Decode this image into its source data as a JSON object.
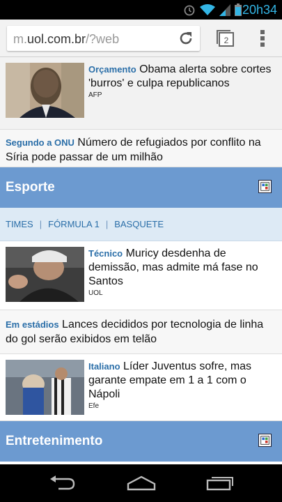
{
  "status_bar": {
    "time": "20h34",
    "icons": [
      "alarm-icon",
      "wifi-icon",
      "signal-icon",
      "battery-icon"
    ],
    "accent_color": "#33b5e5"
  },
  "browser": {
    "url_prefix": "m.",
    "url_domain": "uol.com.br",
    "url_suffix": "/?web",
    "tab_count": "2",
    "icons": [
      "reload-icon",
      "tabs-icon",
      "overflow-menu-icon"
    ]
  },
  "articles_top": [
    {
      "kicker": "Orçamento",
      "headline": "Obama alerta sobre cortes 'burros' e culpa republicanos",
      "source": "AFP"
    }
  ],
  "text_article_1": {
    "kicker": "Segundo a ONU",
    "headline": "Número de refugiados por conflito na Síria pode passar de um milhão"
  },
  "sections": {
    "esporte": {
      "title": "Esporte",
      "color": "#6c9ad0"
    },
    "entretenimento": {
      "title": "Entretenimento",
      "color": "#6c9ad0"
    }
  },
  "subnav": {
    "items": [
      "TIMES",
      "FÓRMULA 1",
      "BASQUETE"
    ]
  },
  "sport_articles": [
    {
      "kicker": "Técnico",
      "headline": "Muricy desdenha de demissão, mas admite má fase no Santos",
      "source": "UOL"
    }
  ],
  "text_article_2": {
    "kicker": "Em estádios",
    "headline": "Lances decididos por tecnologia de linha do gol serão exibidos em telão"
  },
  "sport_articles_2": [
    {
      "kicker": "Italiano",
      "headline": "Líder Juventus sofre, mas garante empate em 1 a 1 com o Nápoli",
      "source": "Efe"
    }
  ],
  "nav_bar": {
    "icons": [
      "back-icon",
      "home-icon",
      "recent-apps-icon"
    ]
  }
}
